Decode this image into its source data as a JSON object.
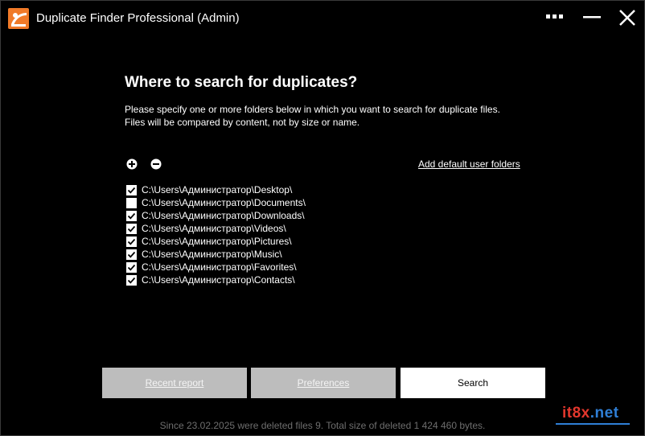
{
  "window": {
    "title": "Duplicate Finder Professional (Admin)"
  },
  "icons": {
    "app": "app-logo-icon",
    "menu": "more-dots-icon",
    "minimize": "minimize-icon",
    "close": "close-icon",
    "add": "plus-circle-icon",
    "remove": "minus-circle-icon",
    "checkbox_checked": "checkmark-icon"
  },
  "main": {
    "heading": "Where to search for duplicates?",
    "description_line1": "Please specify one or more folders below in which you want to search for duplicate files.",
    "description_line2": "Files will be compared by content, not by size or name.",
    "add_default_link": "Add default user folders"
  },
  "folders": [
    {
      "path": "C:\\Users\\Администратор\\Desktop\\",
      "checked": true
    },
    {
      "path": "C:\\Users\\Администратор\\Documents\\",
      "checked": false
    },
    {
      "path": "C:\\Users\\Администратор\\Downloads\\",
      "checked": true
    },
    {
      "path": "C:\\Users\\Администратор\\Videos\\",
      "checked": true
    },
    {
      "path": "C:\\Users\\Администратор\\Pictures\\",
      "checked": true
    },
    {
      "path": "C:\\Users\\Администратор\\Music\\",
      "checked": true
    },
    {
      "path": "C:\\Users\\Администратор\\Favorites\\",
      "checked": true
    },
    {
      "path": "C:\\Users\\Администратор\\Contacts\\",
      "checked": true
    }
  ],
  "buttons": {
    "recent_report": "Recent report",
    "preferences": "Preferences",
    "search": "Search"
  },
  "footer": {
    "status": "Since 23.02.2025 were deleted files 9. Total size of deleted 1 424 460 bytes."
  },
  "watermark": {
    "part1": "it8x",
    "part2": ".net"
  },
  "colors": {
    "background": "#000000",
    "accent": "#f07a28",
    "disabled_button": "#bdbdbd",
    "footer_text": "#6e6e6e"
  }
}
